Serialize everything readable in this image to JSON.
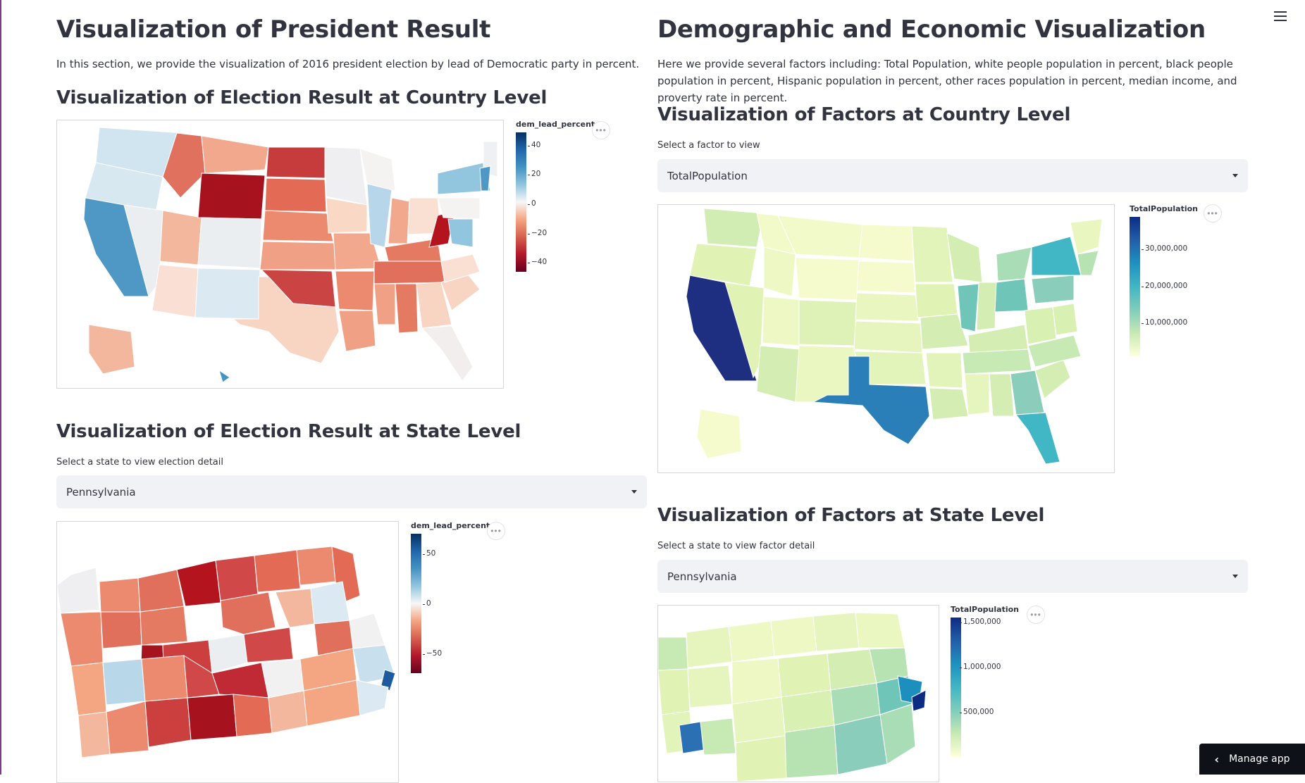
{
  "left": {
    "title": "Visualization of President Result",
    "intro": "In this section, we provide the visualization of 2016 president election by lead of Democratic party in percent.",
    "country_section": {
      "heading": "Visualization of Election Result at Country Level",
      "legend_title": "dem_lead_percent",
      "legend_ticks": [
        "40",
        "20",
        "0",
        "−20",
        "−40"
      ]
    },
    "state_section": {
      "heading": "Visualization of Election Result at State Level",
      "select_label": "Select a state to view election detail",
      "selected": "Pennsylvania",
      "legend_title": "dem_lead_percent",
      "legend_ticks": [
        "50",
        "0",
        "−50"
      ]
    }
  },
  "right": {
    "title": "Demographic and Economic Visualization",
    "intro": "Here we provide several factors including: Total Population, white people population in percent, black people population in percent, Hispanic population in percent, other races population in percent, median income, and proverty rate in percent.",
    "country_section": {
      "heading": "Visualization of Factors at Country Level",
      "select_label": "Select a factor to view",
      "selected": "TotalPopulation",
      "legend_title": "TotalPopulation",
      "legend_ticks": [
        "30,000,000",
        "20,000,000",
        "10,000,000"
      ]
    },
    "state_section": {
      "heading": "Visualization of Factors at State Level",
      "select_label": "Select a state to view factor detail",
      "selected": "Pennsylvania",
      "legend_title": "TotalPopulation",
      "legend_ticks": [
        "1,500,000",
        "1,000,000",
        "500,000"
      ]
    }
  },
  "more_menu": "•••",
  "manage_app": {
    "label": "Manage app",
    "chevron": "‹"
  },
  "icons": [
    "hamburger-menu-icon",
    "more-options-icon",
    "chevron-left-icon",
    "caret-down-icon"
  ],
  "colors": {
    "diverging": [
      "#67001f",
      "#d6604d",
      "#f4a582",
      "#f7f7f7",
      "#92c5de",
      "#4393c3",
      "#053061"
    ],
    "sequential": [
      "#ffffd9",
      "#c7e9b4",
      "#7fcdbb",
      "#41b6c4",
      "#1d91c0",
      "#225ea8",
      "#0c2c84"
    ]
  }
}
